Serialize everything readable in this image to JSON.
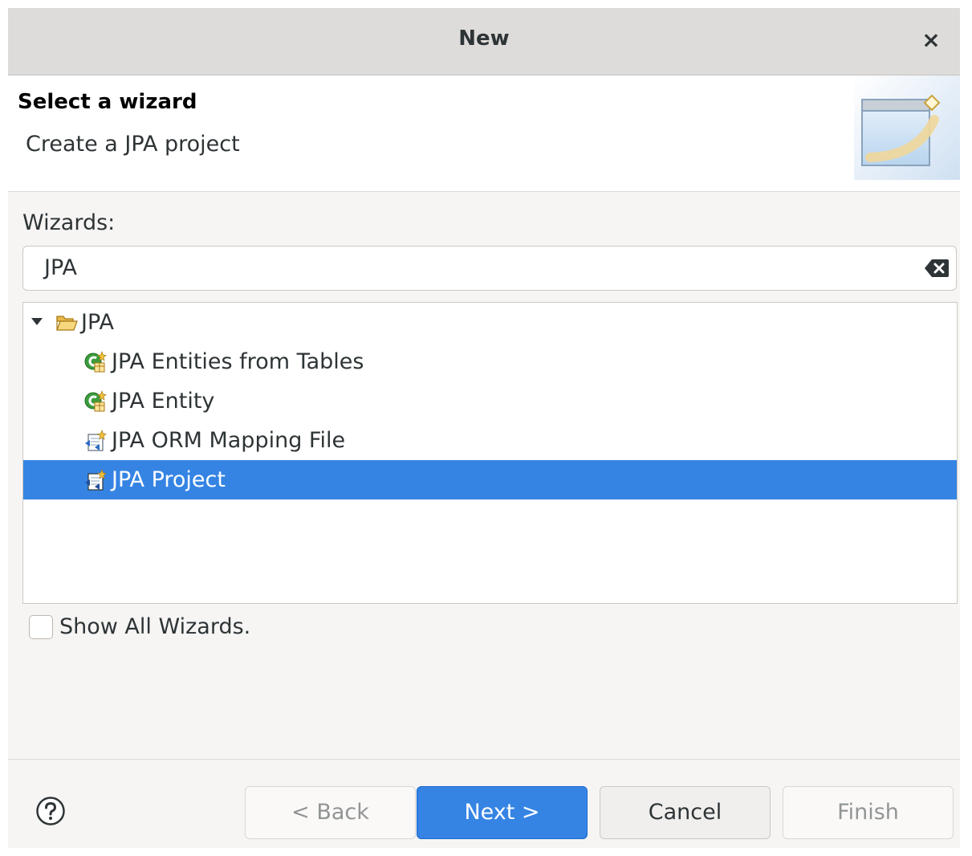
{
  "window": {
    "title": "New",
    "close_glyph": "×"
  },
  "header": {
    "title": "Select a wizard",
    "description": "Create a JPA project",
    "banner_icon": "new-wizard-banner-icon"
  },
  "wizards": {
    "label": "Wizards:",
    "filter_value": "JPA",
    "clear_icon": "clear-text-icon"
  },
  "tree": {
    "category": {
      "label": "JPA",
      "expanded": true,
      "icon": "open-folder-icon"
    },
    "items": [
      {
        "label": "JPA Entities from Tables",
        "icon": "jpa-entity-icon",
        "selected": false
      },
      {
        "label": "JPA Entity",
        "icon": "jpa-entity-icon",
        "selected": false
      },
      {
        "label": "JPA ORM Mapping File",
        "icon": "jpa-file-icon",
        "selected": false
      },
      {
        "label": "JPA Project",
        "icon": "jpa-project-icon",
        "selected": true
      }
    ]
  },
  "show_all": {
    "label": "Show All Wizards.",
    "checked": false
  },
  "buttons": {
    "help_icon": "help-icon",
    "back": "< Back",
    "next": "Next >",
    "cancel": "Cancel",
    "finish": "Finish"
  },
  "colors": {
    "selection": "#3584e4",
    "titlebar": "#dedcda",
    "dialog_bg": "#f6f5f4"
  }
}
